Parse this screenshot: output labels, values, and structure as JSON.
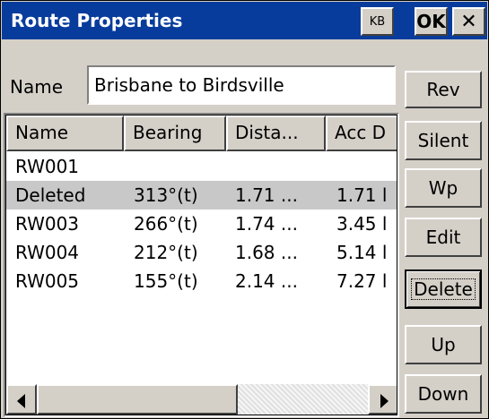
{
  "window": {
    "title": "Route Properties",
    "kb_label": "KB",
    "ok_label": "OK",
    "close_label": "✕"
  },
  "name_field": {
    "label": "Name",
    "value": "Brisbane to Birdsville"
  },
  "list": {
    "columns": [
      "Name",
      "Bearing",
      "Dista...",
      "Acc D"
    ],
    "rows": [
      {
        "name": "RW001",
        "bearing": "",
        "distance": "",
        "acc": ""
      },
      {
        "name": "Deleted",
        "bearing": "313°(t)",
        "distance": "1.71 ...",
        "acc": "1.71 l",
        "selected": true
      },
      {
        "name": "RW003",
        "bearing": "266°(t)",
        "distance": "1.74 ...",
        "acc": "3.45 l"
      },
      {
        "name": "RW004",
        "bearing": "212°(t)",
        "distance": "1.68 ...",
        "acc": "5.14 l"
      },
      {
        "name": "RW005",
        "bearing": "155°(t)",
        "distance": "2.14 ...",
        "acc": "7.27 l"
      }
    ]
  },
  "buttons": {
    "rev": "Rev",
    "silent": "Silent",
    "wp": "Wp",
    "edit": "Edit",
    "delete": "Delete",
    "up": "Up",
    "down": "Down"
  },
  "icons": {
    "scroll_left": "left-arrow-icon",
    "scroll_right": "right-arrow-icon",
    "close": "close-icon"
  },
  "colors": {
    "titlebar": "#083c9c",
    "selection": "#c8c8c8"
  }
}
